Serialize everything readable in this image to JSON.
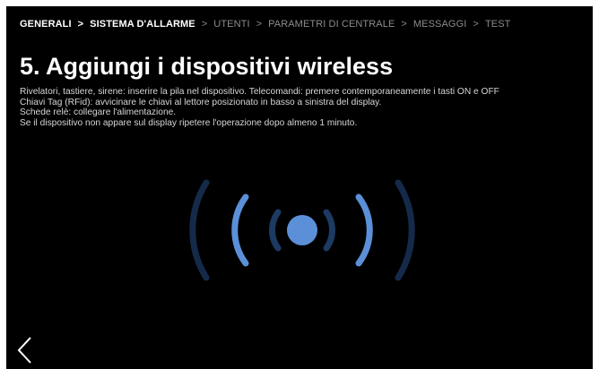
{
  "breadcrumb": {
    "items": [
      {
        "label": "GENERALI"
      },
      {
        "label": "SISTEMA D'ALLARME"
      },
      {
        "label": "UTENTI"
      },
      {
        "label": "PARAMETRI DI CENTRALE"
      },
      {
        "label": "MESSAGGI"
      },
      {
        "label": "TEST"
      }
    ],
    "separator": ">"
  },
  "page": {
    "title": "5. Aggiungi i dispositivi wireless",
    "instructions": [
      "Rivelatori, tastiere, sirene: inserire la pila nel dispositivo. Telecomandi: premere contemporaneamente i tasti ON e OFF",
      "Chiavi Tag (RFid): avvicinare le chiavi al lettore posizionato in basso a sinistra del display.",
      "Schede relè: collegare l'alimentazione.",
      "Se il dispositivo non appare sul display ripetere l'operazione dopo almeno 1 minuto."
    ]
  },
  "icons": {
    "wireless": "wireless-signal-icon",
    "back": "chevron-left-icon"
  },
  "colors": {
    "background": "#000000",
    "accent": "#5b8fd8",
    "signal_dark": "#152a4a",
    "signal_mid": "#1c3a62"
  }
}
